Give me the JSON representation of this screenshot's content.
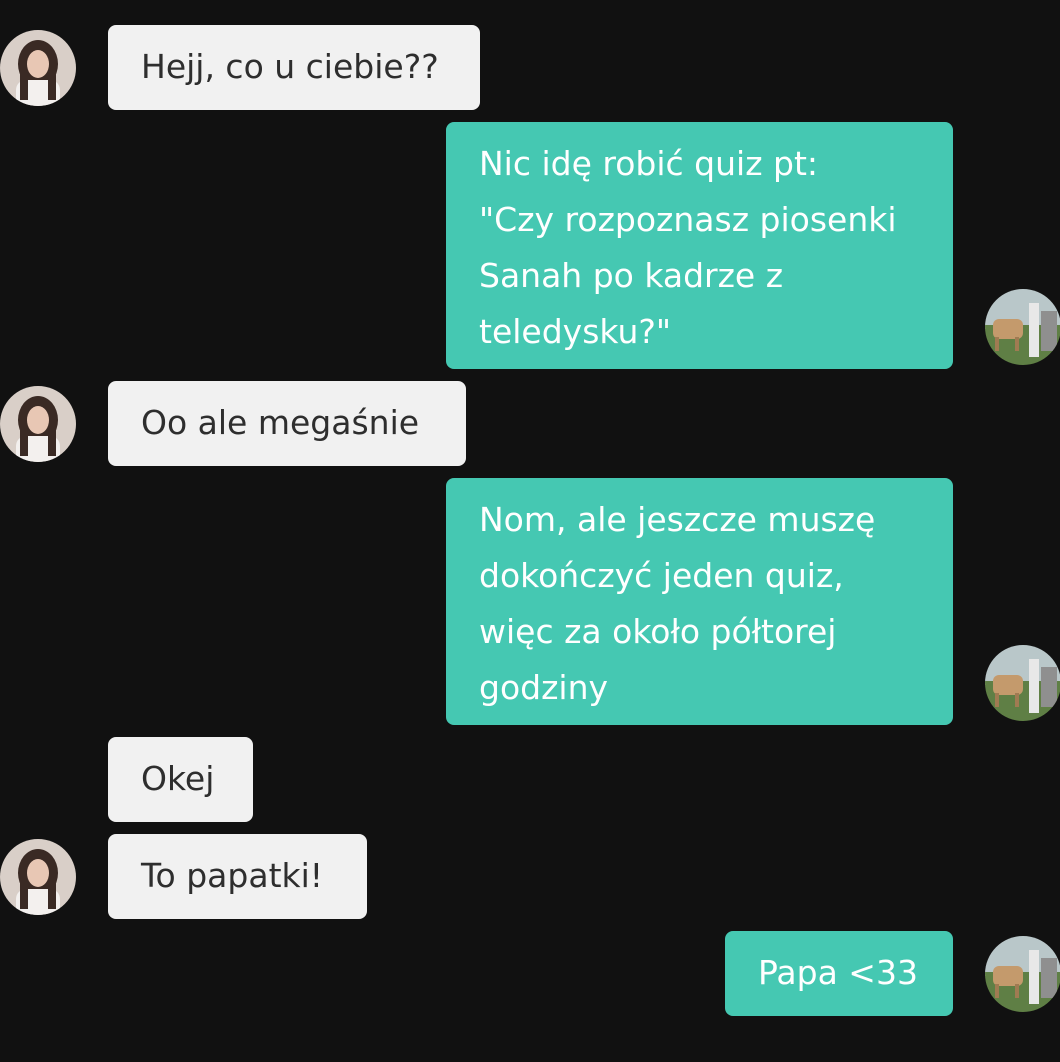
{
  "colors": {
    "background": "#111111",
    "incoming_bubble": "#f1f1f1",
    "incoming_text": "#2e2e2e",
    "outgoing_bubble": "#45c8b2",
    "outgoing_text": "#ffffff"
  },
  "avatars": {
    "contact": "contact-avatar-photo",
    "self": "self-avatar-photo"
  },
  "messages": [
    {
      "sender": "contact",
      "lines": [
        "Hejj, co u ciebie??"
      ]
    },
    {
      "sender": "self",
      "lines": [
        "Nic idę robić quiz pt:",
        "\"Czy rozpoznasz piosenki",
        "Sanah po kadrze z",
        "teledysku?\""
      ]
    },
    {
      "sender": "contact",
      "lines": [
        "Oo ale megaśnie"
      ]
    },
    {
      "sender": "self",
      "lines": [
        "Nom, ale jeszcze muszę",
        "dokończyć jeden quiz,",
        "więc za około półtorej",
        "godziny"
      ]
    },
    {
      "sender": "contact",
      "lines": [
        "Okej"
      ]
    },
    {
      "sender": "contact",
      "lines": [
        "To papatki!"
      ]
    },
    {
      "sender": "self",
      "lines": [
        "Papa <33"
      ]
    }
  ]
}
